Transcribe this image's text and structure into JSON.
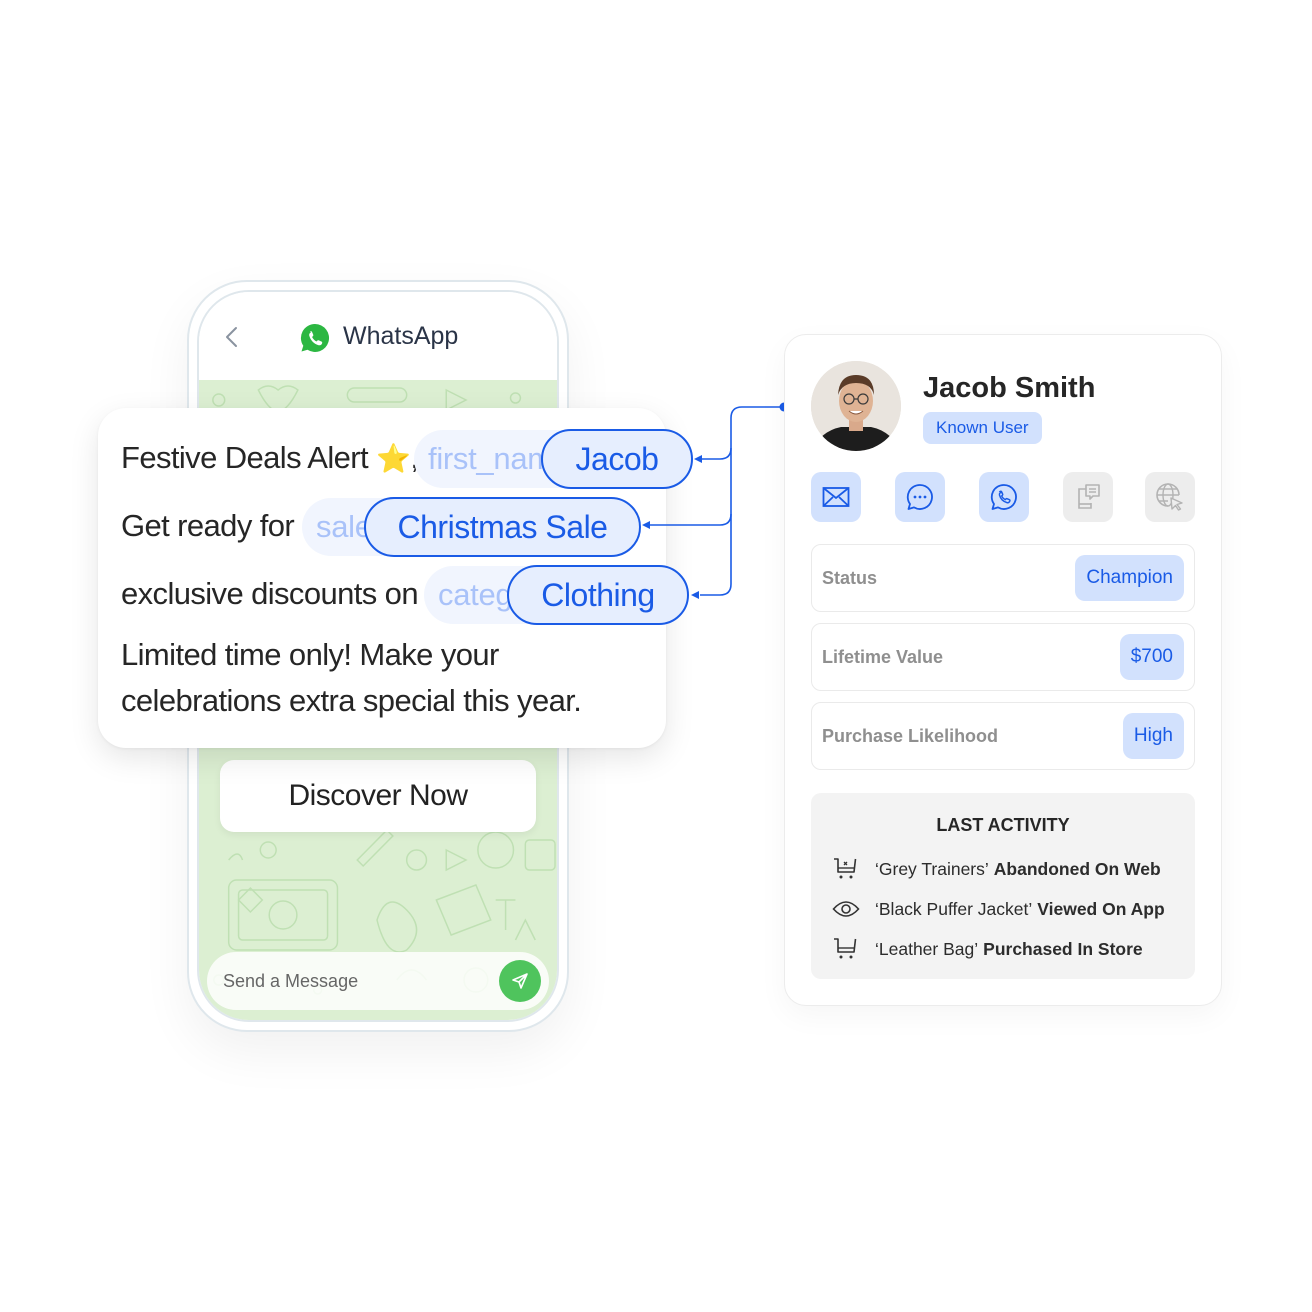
{
  "phone": {
    "back_icon": "chevron-left-icon",
    "app_icon": "whatsapp-logo-icon",
    "app_title": "WhatsApp",
    "cta_label": "Discover Now",
    "compose_placeholder": "Send a Message",
    "send_icon": "paper-plane-icon"
  },
  "message": {
    "line1_text": "Festive Deals Alert",
    "line1_emoji": "⭐",
    "line1_comma": ",",
    "line2_text": "Get ready for",
    "line3_text": "exclusive discounts on",
    "line4_text": "Limited time only! Make your",
    "line5_text": "celebrations extra special this year.",
    "variables": [
      {
        "placeholder": "first_name",
        "value": "Jacob"
      },
      {
        "placeholder": "sale_name",
        "value": "Christmas Sale"
      },
      {
        "placeholder": "category",
        "value": "Clothing"
      }
    ]
  },
  "profile": {
    "name": "Jacob Smith",
    "badge": "Known User",
    "channels": [
      {
        "icon": "email-icon",
        "active": true
      },
      {
        "icon": "chat-bubble-icon",
        "active": true
      },
      {
        "icon": "whatsapp-icon",
        "active": true
      },
      {
        "icon": "mobile-message-icon",
        "active": false
      },
      {
        "icon": "web-cursor-icon",
        "active": false
      }
    ],
    "attributes": [
      {
        "label": "Status",
        "value": "Champion"
      },
      {
        "label": "Lifetime Value",
        "value": "$700"
      },
      {
        "label": "Purchase Likelihood",
        "value": "High"
      }
    ],
    "last_activity": {
      "title": "LAST ACTIVITY",
      "items": [
        {
          "icon": "cart-abandoned-icon",
          "item": "‘Grey Trainers’",
          "action": "Abandoned On Web"
        },
        {
          "icon": "eye-icon",
          "item": "‘Black Puffer Jacket’",
          "action": "Viewed On App"
        },
        {
          "icon": "cart-icon",
          "item": "‘Leather Bag’",
          "action": "Purchased In Store"
        }
      ]
    }
  },
  "colors": {
    "accent_blue": "#1a5be6",
    "pill_blue_bg": "#d2e1fd",
    "whatsapp_green": "#4fc45d",
    "chat_bg_green": "#dcefd2"
  }
}
